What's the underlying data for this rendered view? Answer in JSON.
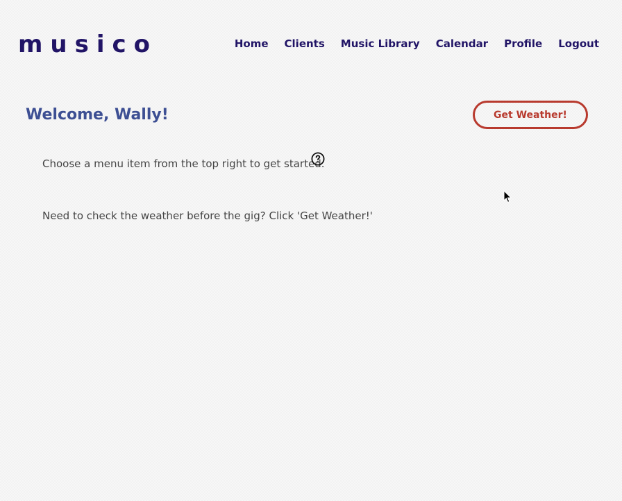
{
  "brand": {
    "logo_text": "musico"
  },
  "nav": {
    "items": [
      {
        "label": "Home"
      },
      {
        "label": "Clients"
      },
      {
        "label": "Music Library"
      },
      {
        "label": "Calendar"
      },
      {
        "label": "Profile"
      },
      {
        "label": "Logout"
      }
    ]
  },
  "main": {
    "welcome": "Welcome, Wally!",
    "weather_button": "Get Weather!",
    "instructions": "Choose a menu item from the top right to get started.",
    "weather_hint": "Need to check the weather before the gig? Click 'Get Weather!'"
  },
  "icons": {
    "help": "help-circle-icon",
    "cursor": "mouse-pointer-icon"
  },
  "colors": {
    "brand": "#211466",
    "welcome": "#3d4f93",
    "accent": "#b83a2e",
    "text": "#444444"
  }
}
